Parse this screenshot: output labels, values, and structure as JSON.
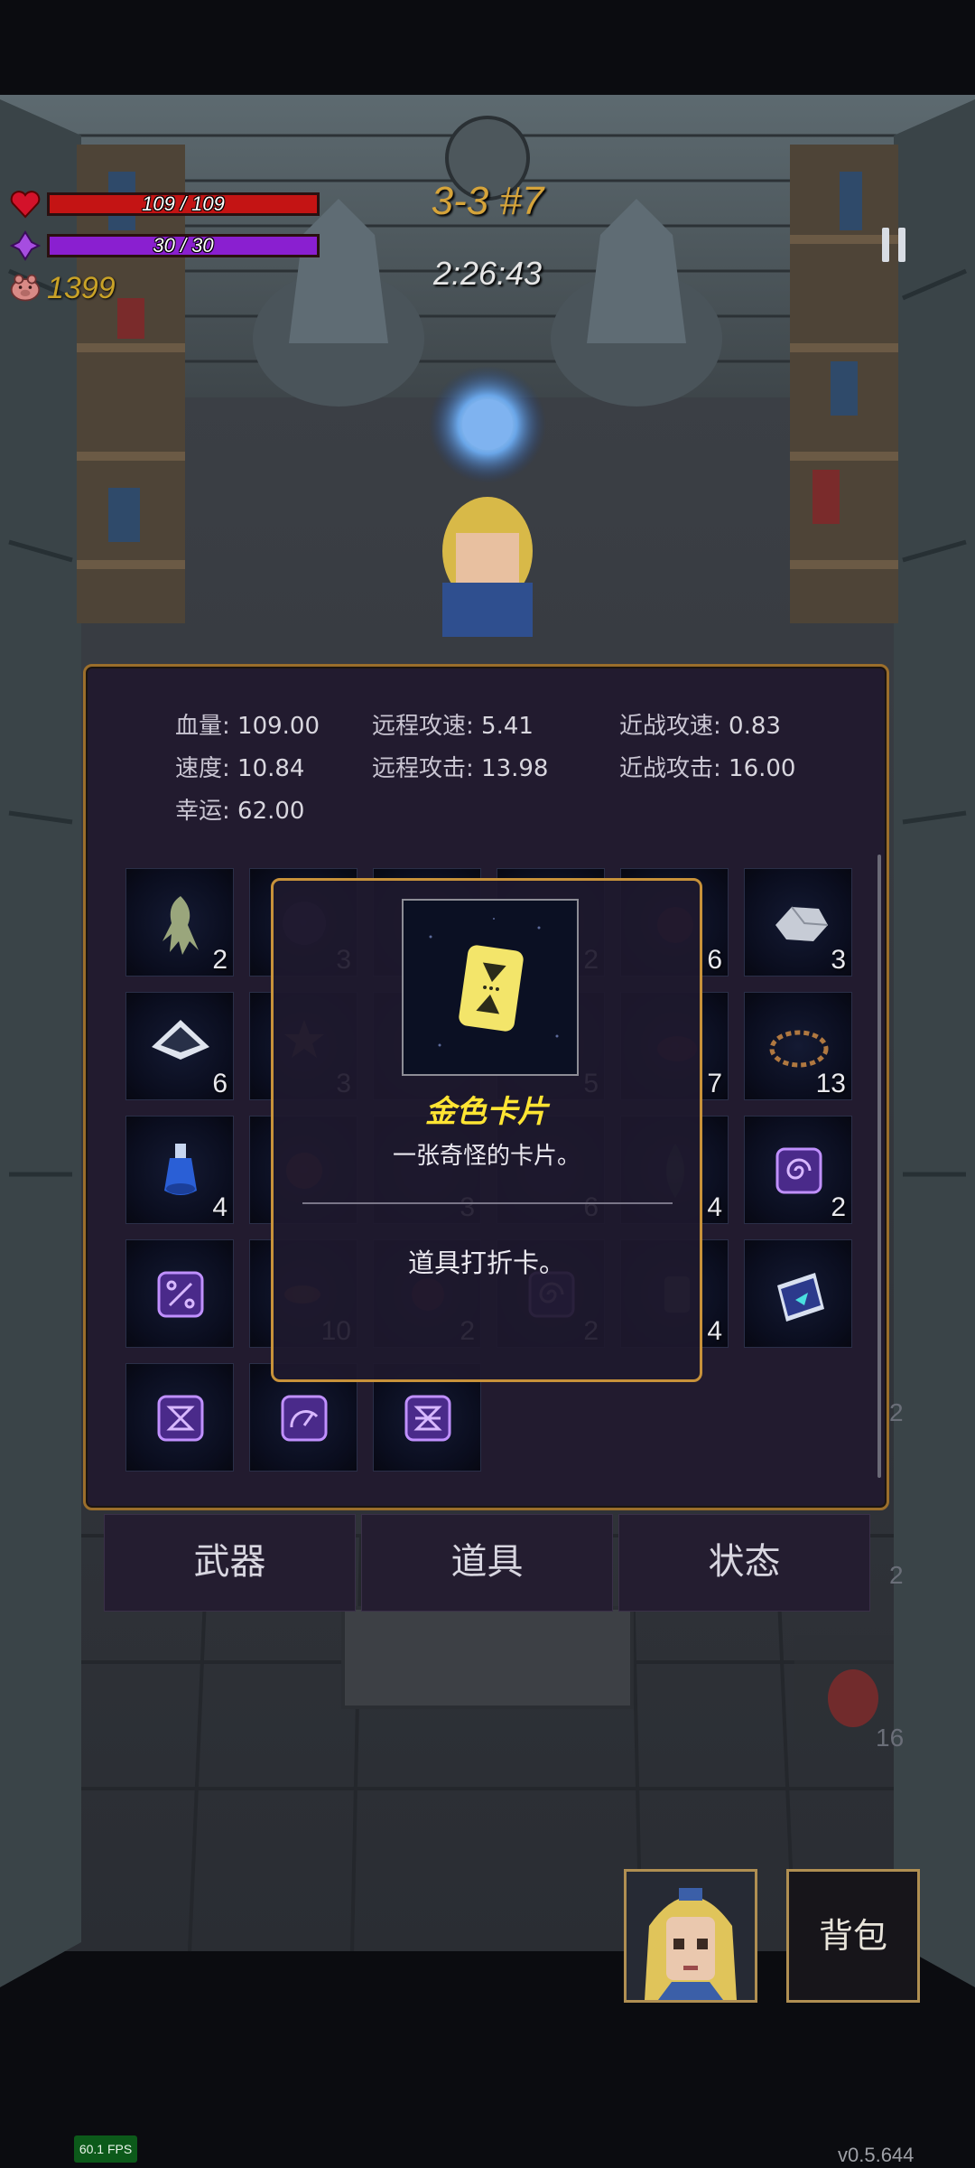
{
  "hud": {
    "hp_text": "109 / 109",
    "hp_fraction": 1.0,
    "mana_text": "30 / 30",
    "mana_fraction": 1.0,
    "coins": "1399",
    "level": "3-3 #7",
    "timer": "2:26:43",
    "colors": {
      "hp": "#c41414",
      "mana": "#8a1fd0",
      "coins": "#c9a227",
      "level": "#d6a43a"
    }
  },
  "stats": [
    {
      "label": "血量:",
      "value": "109.00"
    },
    {
      "label": "远程攻速:",
      "value": "5.41"
    },
    {
      "label": "近战攻速:",
      "value": "0.83"
    },
    {
      "label": "速度:",
      "value": "10.84"
    },
    {
      "label": "远程攻击:",
      "value": "13.98"
    },
    {
      "label": "近战攻击:",
      "value": "16.00"
    },
    {
      "label": "幸运:",
      "value": "62.00"
    }
  ],
  "inventory": [
    {
      "icon": "squid-icon",
      "count": "2"
    },
    {
      "icon": "orb-icon",
      "count": "3"
    },
    {
      "icon": "hidden-item-icon",
      "count": ""
    },
    {
      "icon": "hidden-item-icon",
      "count": "2"
    },
    {
      "icon": "apple-icon",
      "count": "6"
    },
    {
      "icon": "crystal-rock-icon",
      "count": "3"
    },
    {
      "icon": "diamond-plate-icon",
      "count": "6"
    },
    {
      "icon": "star-trophy-icon",
      "count": "3"
    },
    {
      "icon": "hidden-item-icon",
      "count": ""
    },
    {
      "icon": "hidden-item-icon",
      "count": "5"
    },
    {
      "icon": "red-hat-icon",
      "count": "7"
    },
    {
      "icon": "thorn-crown-icon",
      "count": "13"
    },
    {
      "icon": "blue-potion-icon",
      "count": "4"
    },
    {
      "icon": "demon-mask-icon",
      "count": ""
    },
    {
      "icon": "hidden-item-icon",
      "count": "3"
    },
    {
      "icon": "hidden-item-icon",
      "count": "6"
    },
    {
      "icon": "leaf-icon",
      "count": "4"
    },
    {
      "icon": "spiral-rune-icon",
      "count": "2"
    },
    {
      "icon": "percent-rune-icon",
      "count": ""
    },
    {
      "icon": "fish-icon",
      "count": "10"
    },
    {
      "icon": "red-orb-icon",
      "count": "2"
    },
    {
      "icon": "spiral-rune-icon",
      "count": "2"
    },
    {
      "icon": "card-icon",
      "count": "4"
    },
    {
      "icon": "spellbook-icon",
      "count": ""
    },
    {
      "icon": "hourglass-rune-icon",
      "count": ""
    },
    {
      "icon": "gauge-rune-icon",
      "count": ""
    },
    {
      "icon": "crossed-hourglass-rune-icon",
      "count": ""
    }
  ],
  "tooltip": {
    "name": "金色卡片",
    "description": "一张奇怪的卡片。",
    "effect": "道具打折卡。",
    "icon": "gold-card-icon"
  },
  "tabs": [
    {
      "label": "武器"
    },
    {
      "label": "道具"
    },
    {
      "label": "状态"
    }
  ],
  "backpack_label": "背包",
  "fps": "60.1 FPS",
  "version": "v0.5.644",
  "background_counts": [
    "2",
    "2",
    "16"
  ]
}
